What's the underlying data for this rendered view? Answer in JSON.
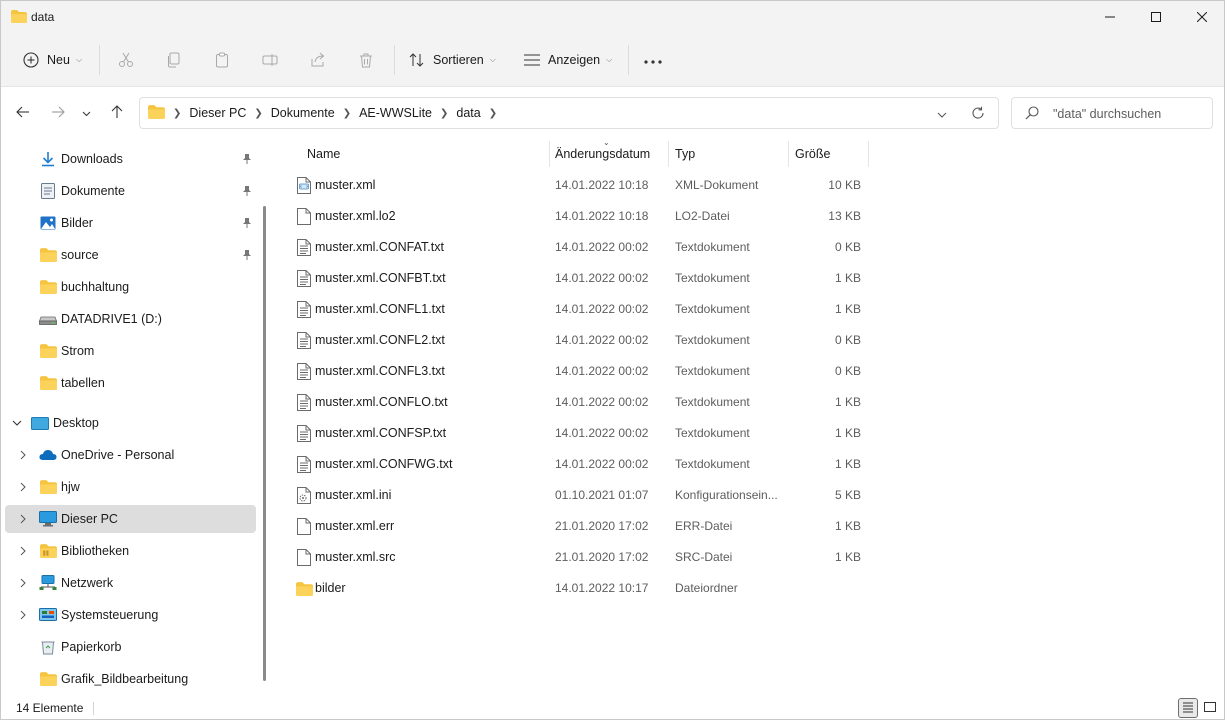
{
  "window": {
    "title": "data"
  },
  "toolbar": {
    "new_label": "Neu",
    "sort_label": "Sortieren",
    "view_label": "Anzeigen"
  },
  "address": {
    "crumbs": [
      "Dieser PC",
      "Dokumente",
      "AE-WWSLite",
      "data"
    ]
  },
  "search": {
    "placeholder": "\"data\" durchsuchen"
  },
  "sidebar": {
    "items": [
      {
        "label": "Downloads",
        "icon": "download-icon",
        "pinned": true
      },
      {
        "label": "Dokumente",
        "icon": "document-icon",
        "pinned": true
      },
      {
        "label": "Bilder",
        "icon": "pictures-icon",
        "pinned": true
      },
      {
        "label": "source",
        "icon": "folder-icon",
        "pinned": true
      },
      {
        "label": "buchhaltung",
        "icon": "folder-icon",
        "pinned": false
      },
      {
        "label": "DATADRIVE1 (D:)",
        "icon": "drive-icon",
        "pinned": false
      },
      {
        "label": "Strom",
        "icon": "folder-icon",
        "pinned": false
      },
      {
        "label": "tabellen",
        "icon": "folder-icon",
        "pinned": false
      },
      {
        "label": "Desktop",
        "icon": "desktop-icon",
        "expanded": true
      },
      {
        "label": "OneDrive - Personal",
        "icon": "cloud-icon"
      },
      {
        "label": "hjw",
        "icon": "folder-icon"
      },
      {
        "label": "Dieser PC",
        "icon": "monitor-icon",
        "selected": true
      },
      {
        "label": "Bibliotheken",
        "icon": "library-icon"
      },
      {
        "label": "Netzwerk",
        "icon": "network-icon"
      },
      {
        "label": "Systemsteuerung",
        "icon": "control-panel-icon"
      },
      {
        "label": "Papierkorb",
        "icon": "recycle-bin-icon"
      },
      {
        "label": "Grafik_Bildbearbeitung",
        "icon": "folder-icon"
      }
    ]
  },
  "columns": {
    "name": "Name",
    "date": "Änderungsdatum",
    "type": "Typ",
    "size": "Größe"
  },
  "files": [
    {
      "name": "muster.xml",
      "date": "14.01.2022 10:18",
      "type": "XML-Dokument",
      "size": "10 KB",
      "icon": "xml-file-icon"
    },
    {
      "name": "muster.xml.lo2",
      "date": "14.01.2022 10:18",
      "type": "LO2-Datei",
      "size": "13 KB",
      "icon": "file-icon"
    },
    {
      "name": "muster.xml.CONFAT.txt",
      "date": "14.01.2022 00:02",
      "type": "Textdokument",
      "size": "0 KB",
      "icon": "text-file-icon"
    },
    {
      "name": "muster.xml.CONFBT.txt",
      "date": "14.01.2022 00:02",
      "type": "Textdokument",
      "size": "1 KB",
      "icon": "text-file-icon"
    },
    {
      "name": "muster.xml.CONFL1.txt",
      "date": "14.01.2022 00:02",
      "type": "Textdokument",
      "size": "1 KB",
      "icon": "text-file-icon"
    },
    {
      "name": "muster.xml.CONFL2.txt",
      "date": "14.01.2022 00:02",
      "type": "Textdokument",
      "size": "0 KB",
      "icon": "text-file-icon"
    },
    {
      "name": "muster.xml.CONFL3.txt",
      "date": "14.01.2022 00:02",
      "type": "Textdokument",
      "size": "0 KB",
      "icon": "text-file-icon"
    },
    {
      "name": "muster.xml.CONFLO.txt",
      "date": "14.01.2022 00:02",
      "type": "Textdokument",
      "size": "1 KB",
      "icon": "text-file-icon"
    },
    {
      "name": "muster.xml.CONFSP.txt",
      "date": "14.01.2022 00:02",
      "type": "Textdokument",
      "size": "1 KB",
      "icon": "text-file-icon"
    },
    {
      "name": "muster.xml.CONFWG.txt",
      "date": "14.01.2022 00:02",
      "type": "Textdokument",
      "size": "1 KB",
      "icon": "text-file-icon"
    },
    {
      "name": "muster.xml.ini",
      "date": "01.10.2021 01:07",
      "type": "Konfigurationsein...",
      "size": "5 KB",
      "icon": "settings-file-icon"
    },
    {
      "name": "muster.xml.err",
      "date": "21.01.2020 17:02",
      "type": "ERR-Datei",
      "size": "1 KB",
      "icon": "file-icon"
    },
    {
      "name": "muster.xml.src",
      "date": "21.01.2020 17:02",
      "type": "SRC-Datei",
      "size": "1 KB",
      "icon": "file-icon"
    },
    {
      "name": "bilder",
      "date": "14.01.2022 10:17",
      "type": "Dateiordner",
      "size": "",
      "icon": "folder-icon"
    }
  ],
  "status": {
    "count": "14 Elemente"
  },
  "colors": {
    "folder": "#f5c542",
    "accent": "#0067c0",
    "selection": "#dddddd"
  }
}
